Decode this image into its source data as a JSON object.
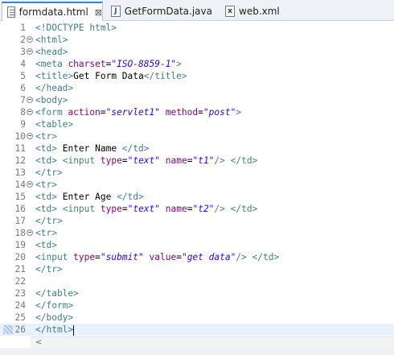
{
  "tabs": [
    {
      "label": "formdata.html",
      "icon": "html-file-icon",
      "active": true,
      "close": "⊠"
    },
    {
      "label": "GetFormData.java",
      "icon": "java-file-icon",
      "active": false
    },
    {
      "label": "web.xml",
      "icon": "xml-file-icon",
      "active": false
    }
  ],
  "editor": {
    "lines": [
      {
        "n": "1",
        "text": "<!DOCTYPE html>"
      },
      {
        "n": "2",
        "text": "<html>"
      },
      {
        "n": "3",
        "text": "<head>"
      },
      {
        "n": "4",
        "text": "<meta charset=\"ISO-8859-1\">"
      },
      {
        "n": "5",
        "text": "<title>Get Form Data</title>"
      },
      {
        "n": "6",
        "text": "</head>"
      },
      {
        "n": "7",
        "text": "<body>"
      },
      {
        "n": "8",
        "text": "<form action=\"servlet1\" method=\"post\">"
      },
      {
        "n": "9",
        "text": "<table>"
      },
      {
        "n": "10",
        "text": "<tr>"
      },
      {
        "n": "11",
        "text": "<td> Enter Name </td>"
      },
      {
        "n": "12",
        "text": "<td> <input type=\"text\" name=\"t1\"/> </td>"
      },
      {
        "n": "13",
        "text": "</tr>"
      },
      {
        "n": "14",
        "text": "<tr>"
      },
      {
        "n": "15",
        "text": "<td> Enter Age </td>"
      },
      {
        "n": "16",
        "text": "<td> <input type=\"text\" name=\"t2\"/> </td>"
      },
      {
        "n": "17",
        "text": "</tr>"
      },
      {
        "n": "18",
        "text": "<tr>"
      },
      {
        "n": "19",
        "text": "<td>"
      },
      {
        "n": "20",
        "text": "<input type=\"submit\" value=\"get data\"/> </td>"
      },
      {
        "n": "21",
        "text": "</tr>"
      },
      {
        "n": "22",
        "text": ""
      },
      {
        "n": "23",
        "text": "</table>"
      },
      {
        "n": "24",
        "text": "</form>"
      },
      {
        "n": "25",
        "text": "</body>"
      },
      {
        "n": "26",
        "text": "</html>"
      }
    ],
    "folded_lines": [
      "2",
      "3",
      "7",
      "8",
      "10",
      "14",
      "18"
    ],
    "cursor_line": "26"
  },
  "scrollbar": {
    "left_arrow": "<"
  },
  "colors": {
    "tag": "#3f7f7f",
    "attribute": "#7f007f",
    "value": "#2a00ff",
    "line_number": "#787878",
    "active_tab": "#3c7fd6"
  }
}
